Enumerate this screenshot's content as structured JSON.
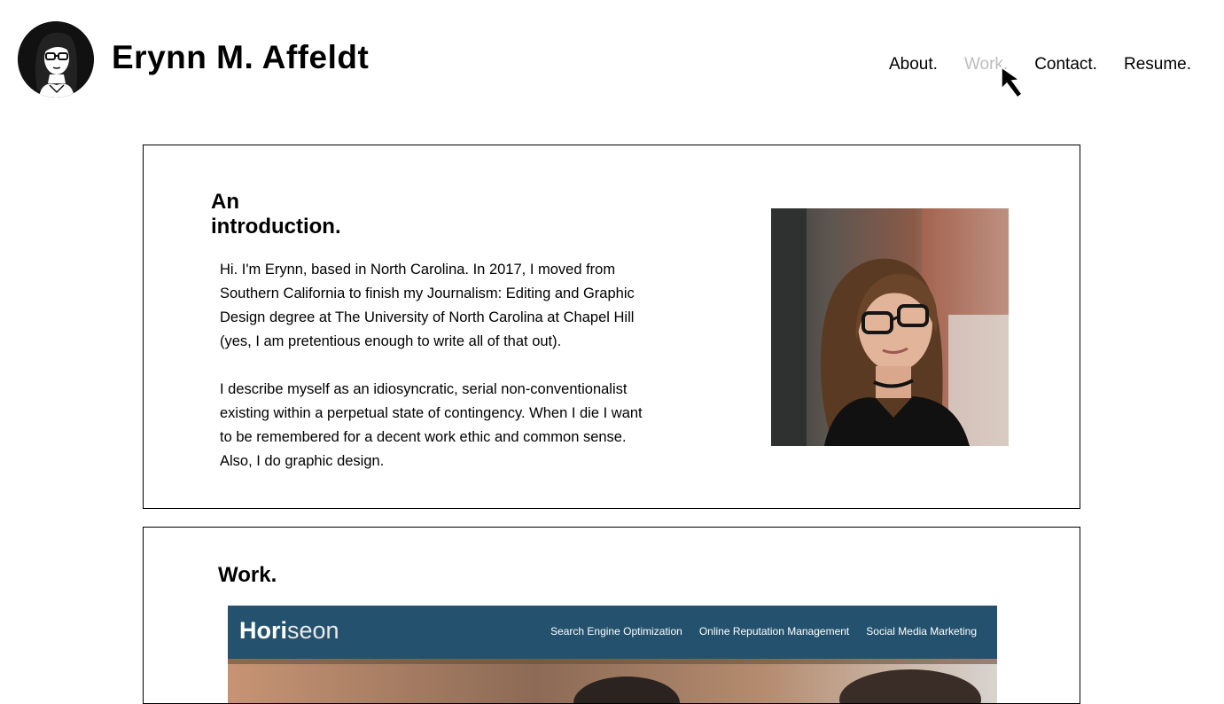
{
  "header": {
    "site_title": "Erynn M. Affeldt",
    "nav": [
      {
        "label": "About."
      },
      {
        "label": "Work."
      },
      {
        "label": "Contact."
      },
      {
        "label": "Resume."
      }
    ]
  },
  "intro": {
    "heading_line1": "An",
    "heading_line2": "introduction.",
    "paragraphs": [
      "Hi. I'm Erynn, based in North Carolina. In 2017, I moved from Southern California to finish my Journalism: Editing and Graphic Design degree at The University of North Carolina at Chapel Hill (yes, I am pretentious enough to write all of that out).",
      "I describe myself as an idiosyncratic, serial non-conventionalist existing within a perpetual state of contingency. When I die I want to be remembered for a decent work ethic and common sense. Also, I do graphic design."
    ]
  },
  "work": {
    "heading": "Work.",
    "preview": {
      "logo_bold": "Hori",
      "logo_light": "seon",
      "nav": [
        "Search Engine Optimization",
        "Online Reputation Management",
        "Social Media Marketing"
      ]
    }
  },
  "colors": {
    "nav_hover": "#bdbdbd",
    "preview_bar": "#24526e"
  }
}
